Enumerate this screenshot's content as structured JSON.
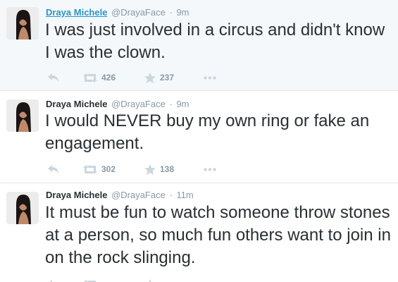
{
  "colors": {
    "name_link": "#2a94c9",
    "icon_gray": "#ccd6dd",
    "meta_gray": "#8899a6",
    "highlight_bg": "#f5f8fa"
  },
  "icons": {
    "reply": "reply-icon",
    "retweet": "retweet-icon",
    "favorite": "star-icon",
    "more": "more-icon",
    "avatar": "avatar"
  },
  "tweets": [
    {
      "name": "Draya Michele",
      "handle": "@DrayaFace",
      "separator": "·",
      "time": "9m",
      "text": "I was just involved in a circus and didn't know I was the clown.",
      "retweets": "426",
      "favorites": "237"
    },
    {
      "name": "Draya Michele",
      "handle": "@DrayaFace",
      "separator": "·",
      "time": "9m",
      "text": "I would NEVER buy my own ring or fake an engagement.",
      "retweets": "302",
      "favorites": "138"
    },
    {
      "name": "Draya Michele",
      "handle": "@DrayaFace",
      "separator": "·",
      "time": "11m",
      "text": "It must be fun to watch someone throw stones at a person, so much fun others want to join in on the rock slinging.",
      "retweets": "",
      "favorites": ""
    }
  ]
}
